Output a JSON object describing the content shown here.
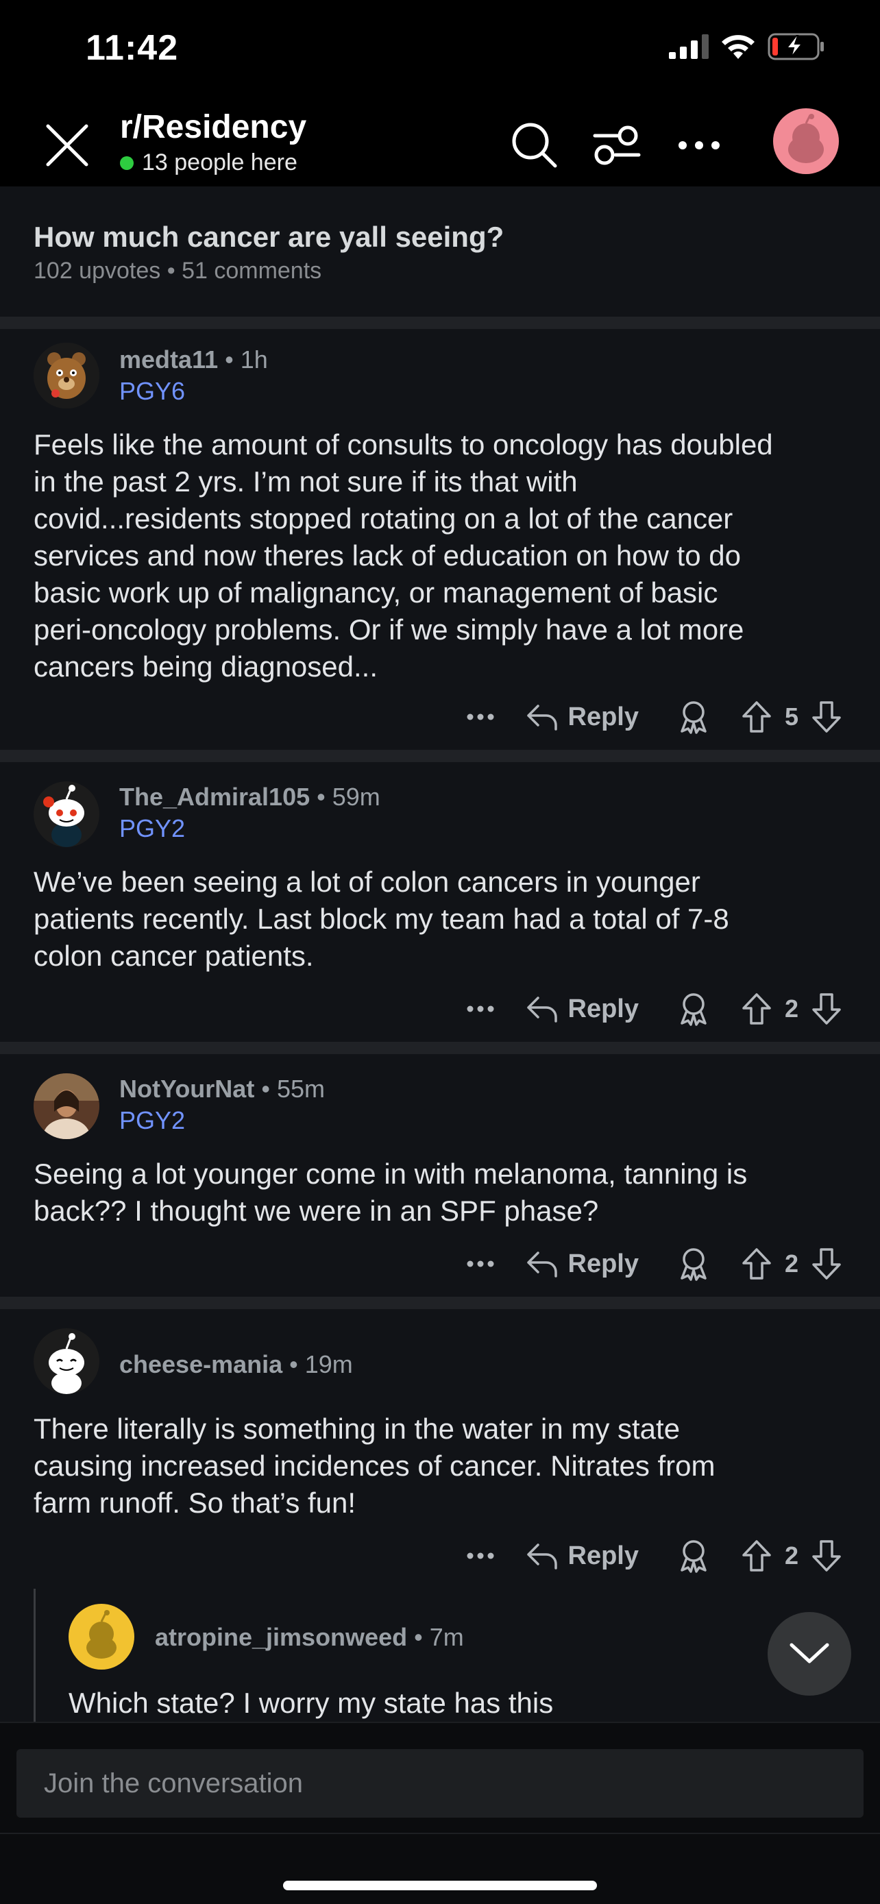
{
  "status_bar": {
    "time": "11:42"
  },
  "header": {
    "subreddit": "r/Residency",
    "online_count": "13 people here",
    "icons": [
      "close-icon",
      "search-icon",
      "filter-icon",
      "more-icon",
      "user-avatar"
    ]
  },
  "post": {
    "title": "How much cancer are yall seeing?",
    "upvotes": "102 upvotes",
    "comments": "51 comments"
  },
  "comments": [
    {
      "author": "medta11",
      "time": "1h",
      "flair": "PGY6",
      "lines": [
        "Feels like the amount of consults to oncology has doubled",
        "in the past 2 yrs. I’m not sure if its that with",
        "covid...residents stopped rotating on a lot of the cancer",
        "services and now theres lack of education on how to do",
        "basic work up of malignancy, or  management of basic",
        "peri-oncology problems. Or if we simply have a lot more",
        "cancers being diagnosed..."
      ],
      "score": "5",
      "reply_label": "Reply"
    },
    {
      "author": "The_Admiral105",
      "time": "59m",
      "flair": "PGY2",
      "lines": [
        "We’ve been seeing a lot of colon cancers in younger",
        "patients recently. Last block my team had a total of 7-8",
        "colon cancer patients."
      ],
      "score": "2",
      "reply_label": "Reply"
    },
    {
      "author": "NotYourNat",
      "time": "55m",
      "flair": "PGY2",
      "lines": [
        "Seeing a lot younger come in with melanoma, tanning is",
        "back?? I thought we were in an SPF phase?"
      ],
      "score": "2",
      "reply_label": "Reply"
    },
    {
      "author": "cheese-mania",
      "time": "19m",
      "flair": "",
      "lines": [
        "There literally is something in the water in my state",
        "causing increased incidences of cancer. Nitrates from",
        "farm runoff. So that’s fun!"
      ],
      "score": "2",
      "reply_label": "Reply"
    },
    {
      "author": "atropine_jimsonweed",
      "time": "7m",
      "flair": "",
      "lines": [
        "Which state? I worry my state has this"
      ]
    }
  ],
  "composer": {
    "placeholder": "Join the conversation"
  },
  "colors": {
    "accent_flair": "#7193ff",
    "online_dot": "#2ecc40",
    "avatar_pink": "#f28b96"
  }
}
